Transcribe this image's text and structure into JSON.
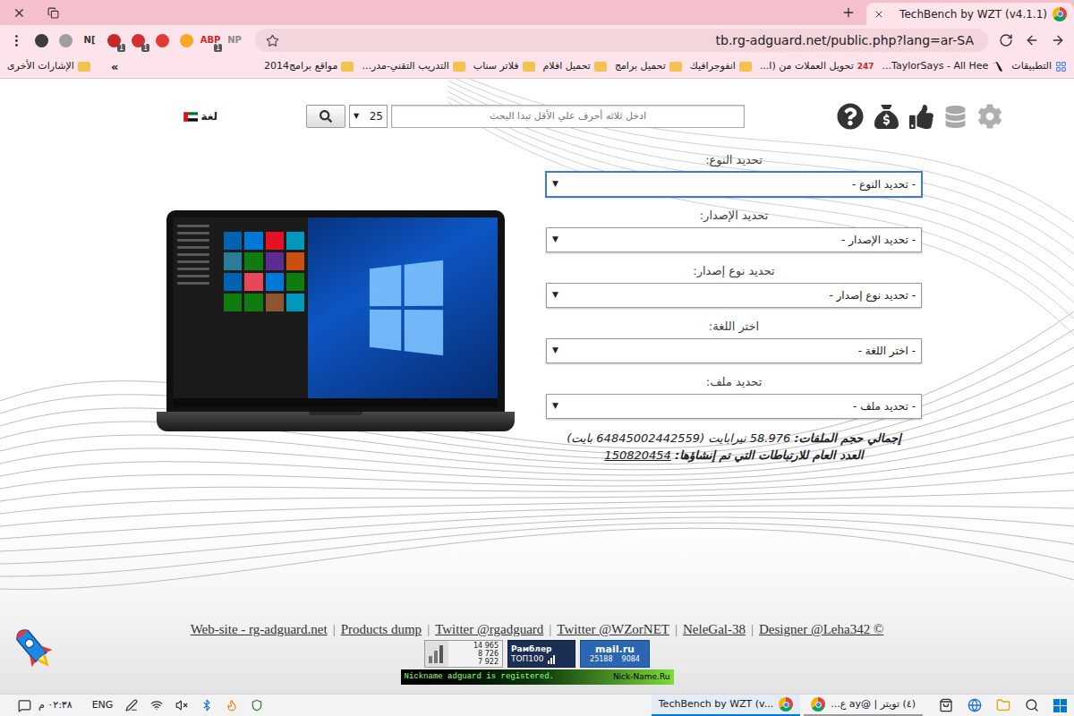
{
  "browser": {
    "tab": {
      "title": "TechBench by WZT (v4.1.1)",
      "selected": true
    },
    "address": "tb.rg-adguard.net/public.php?lang=ar-SA",
    "extensions": [
      {
        "kind": "icon",
        "text": "",
        "color": "#3c3c3c",
        "badge": ""
      },
      {
        "kind": "icon",
        "text": "",
        "color": "#9e9e9e",
        "badge": ""
      },
      {
        "kind": "text",
        "text": "N[",
        "color": "#333333",
        "badge": ""
      },
      {
        "kind": "icon",
        "text": "",
        "color": "#c62828",
        "badge": "1"
      },
      {
        "kind": "icon",
        "text": "",
        "color": "#d32f2f",
        "badge": "1"
      },
      {
        "kind": "icon",
        "text": "",
        "color": "#e53935",
        "badge": ""
      },
      {
        "kind": "icon",
        "text": "",
        "color": "#f9a825",
        "badge": ""
      },
      {
        "kind": "text",
        "text": "ABP",
        "color": "#c62828",
        "badge": "1"
      },
      {
        "kind": "text",
        "text": "NP",
        "color": "#8a8a8a",
        "badge": ""
      }
    ],
    "bookmarks": [
      {
        "label": "التطبيقات",
        "kind": "apps",
        "icon_text": ""
      },
      {
        "label": "TaylorSays - All Hee...",
        "kind": "site",
        "icon_text": ""
      },
      {
        "label": "تحويل العملات من (ا...",
        "kind": "badge-site",
        "icon_text": "247"
      },
      {
        "label": "انفوجرافيك",
        "kind": "folder",
        "icon_text": ""
      },
      {
        "label": "تحميل برامج",
        "kind": "folder",
        "icon_text": ""
      },
      {
        "label": "تحميل افلام",
        "kind": "folder",
        "icon_text": ""
      },
      {
        "label": "فلاتر سناب",
        "kind": "folder",
        "icon_text": ""
      },
      {
        "label": "التدريب التقني-مدر...",
        "kind": "folder",
        "icon_text": ""
      },
      {
        "label": "مواقع برامج2014",
        "kind": "folder",
        "icon_text": ""
      }
    ],
    "bookmarks_overflow": "»",
    "other_bookmarks": "الإشارات الأخرى"
  },
  "page": {
    "search": {
      "placeholder": "ادخل ثلاثه أحرف علي الأقل تبدا البحث",
      "per_page": "25",
      "arrow": "▼"
    },
    "language": {
      "label": "لغة"
    },
    "fields": [
      {
        "label": "تحديد النوع:",
        "value": "- تحديد النوع -",
        "arrow": "▼",
        "focused": true
      },
      {
        "label": "تحديد الإصدار:",
        "value": "- تحديد الإصدار -",
        "arrow": "▼",
        "focused": false
      },
      {
        "label": "تحديد نوع إصدار:",
        "value": "- تحديد نوع إصدار -",
        "arrow": "▼",
        "focused": false
      },
      {
        "label": "اختر اللغة:",
        "value": "- اختر اللغة -",
        "arrow": "▼",
        "focused": false
      },
      {
        "label": "تحديد ملف:",
        "value": "- تحديد ملف -",
        "arrow": "▼",
        "focused": false
      }
    ],
    "stats": {
      "size_label": "إجمالي حجم الملفات:",
      "size_value": "58.976 تيرابايت (64845002442559 بايت)",
      "links_label": "العدد العام للارتباطات التي تم إنشاؤها:",
      "links_value": "150820454"
    },
    "footer": {
      "links": [
        "Web-site - rg-adguard.net",
        "Products dump",
        "Twitter @rgadguard",
        "Twitter @WZorNET",
        "NeleGal-38",
        "Designer @Leha342 ©"
      ],
      "separator": "|",
      "counters": {
        "liveinternet": [
          "14 965",
          "8 726",
          "7 922"
        ],
        "rambler": {
          "name": "Рамблер",
          "rank": "ТОП100"
        },
        "mailru": {
          "name": "mail.ru",
          "values": [
            "25188",
            "9084"
          ]
        }
      },
      "nickname": {
        "text": "Nickname adguard is registered.",
        "site": "Nick-Name.Ru"
      }
    }
  },
  "taskbar": {
    "time": "٠٢:٣٨ م",
    "lang": "ENG",
    "tasks": [
      {
        "label": "TechBench by WZT (v...",
        "selected": true
      },
      {
        "label": "(٤) تويتر | @ay ع...",
        "selected": false
      }
    ]
  }
}
